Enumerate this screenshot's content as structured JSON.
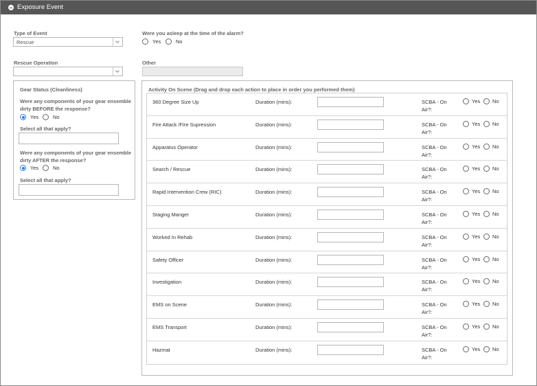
{
  "panel": {
    "title": "Exposure Event"
  },
  "type_of_event": {
    "label": "Type of Event",
    "value": "Rescue"
  },
  "asleep": {
    "question": "Were you asleep at the time of the alarm?",
    "yes": "Yes",
    "no": "No"
  },
  "rescue_operation": {
    "label": "Rescue Operation",
    "value": ""
  },
  "other": {
    "label": "Other",
    "value": ""
  },
  "gear": {
    "title": "Gear Status (Cleanliness)",
    "before_q_line1": "Were any components of your gear ensemble",
    "before_q_line2": "dirty BEFORE the response?",
    "after_q_line1": "Were any components of your gear ensemble",
    "after_q_line2": "dirty AFTER the response?",
    "yes": "Yes",
    "no": "No",
    "before_selected": "Yes",
    "after_selected": "Yes",
    "select_label_1": "Select all that apply?",
    "select_label_2": "Select all that apply?"
  },
  "activity": {
    "title": "Activity On Scene (Drag and drop each action to place in order you performed them)",
    "duration_label": "Duration (mins):",
    "scba_line1": "SCBA - On",
    "scba_line2": "Air?:",
    "yes": "Yes",
    "no": "No",
    "items": [
      "360 Degree Size Up",
      "Fire Attack /Fire Supression",
      "Apparatus Operator",
      "Search / Rescue",
      "Rapid Intervention Crew (RIC)",
      "Staging Manger",
      "Worked In Rehab",
      "Safety Officer",
      "Investigation",
      "EMS on Scene",
      "EMS Transport",
      "Hazmat"
    ]
  }
}
